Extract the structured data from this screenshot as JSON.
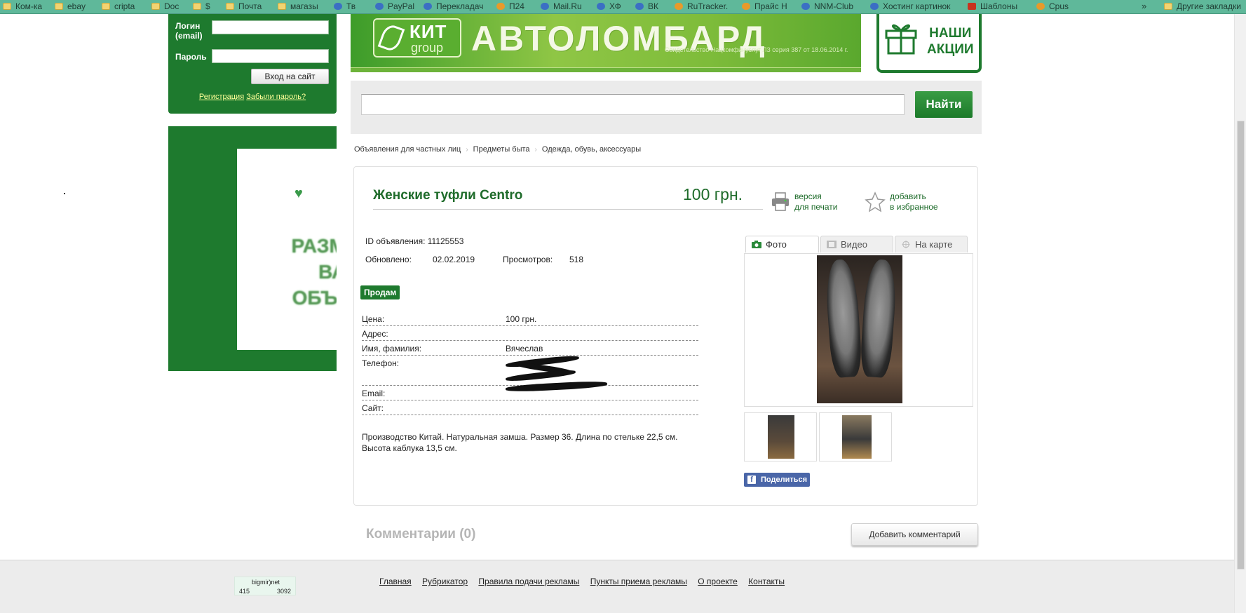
{
  "bookmarks": [
    {
      "label": "Ком-ка",
      "icon": "folder"
    },
    {
      "label": "ebay",
      "icon": "folder"
    },
    {
      "label": "cripta",
      "icon": "folder"
    },
    {
      "label": "Doc",
      "icon": "folder"
    },
    {
      "label": "$",
      "icon": "folder"
    },
    {
      "label": "Почта",
      "icon": "folder"
    },
    {
      "label": "магазы",
      "icon": "folder"
    },
    {
      "label": "Тв",
      "icon": "twitter"
    },
    {
      "label": "PayPal",
      "icon": "paypal"
    },
    {
      "label": "Перекладач",
      "icon": "translate"
    },
    {
      "label": "П24",
      "icon": "p24"
    },
    {
      "label": "Mail.Ru",
      "icon": "mail"
    },
    {
      "label": "ХФ",
      "icon": "hf"
    },
    {
      "label": "ВК",
      "icon": "vk"
    },
    {
      "label": "RuTracker.",
      "icon": "rutracker"
    },
    {
      "label": "Прайс Н",
      "icon": "pin"
    },
    {
      "label": "NNM-Club",
      "icon": "nnm"
    },
    {
      "label": "Хостинг картинок",
      "icon": "hosting"
    },
    {
      "label": "Шаблоны",
      "icon": "vx"
    },
    {
      "label": "Cpus",
      "icon": "cpu"
    }
  ],
  "bookmarks_more": "»",
  "bookmarks_other": "Другие закладки",
  "login": {
    "login_label": "Логин (email)",
    "password_label": "Пароль",
    "submit": "Вход на сайт",
    "register": "Регистрация",
    "forgot": "Забыли пароль?"
  },
  "left_ad": {
    "lines": [
      "РАЗМЕЩ",
      "ВАШЕ",
      "ОБЪЯВЛ"
    ]
  },
  "banner": {
    "logo_top": "КИТ",
    "logo_bottom": "group",
    "main": "АВТОЛОМБАРД",
    "small": "Свидетельство Нацкомфинуслуг ЛЗ серия 387 от 18.06.2014 г."
  },
  "gift": {
    "line1": "НАШИ",
    "line2": "АКЦИИ"
  },
  "search": {
    "value": "",
    "button": "Найти"
  },
  "breadcrumbs": [
    "Объявления для частных лиц",
    "Предметы быта",
    "Одежда, обувь, аксессуары"
  ],
  "breadcrumb_sep": "›",
  "ad": {
    "title": "Женские туфли Centro",
    "price_top": "100 грн.",
    "print_line1": "версия",
    "print_line2": "для печати",
    "fav_line1": "добавить",
    "fav_line2": "в избранное",
    "id_label": "ID объявления:",
    "id_value": "11125553",
    "updated_label": "Обновлено:",
    "updated_value": "02.02.2019",
    "views_label": "Просмотров:",
    "views_value": "518",
    "type_badge": "Продам",
    "rows": [
      {
        "key": "Цена:",
        "value": "100 грн."
      },
      {
        "key": "Адрес:",
        "value": ""
      },
      {
        "key": "Имя, фамилия:",
        "value": "Вячеслав"
      },
      {
        "key": "Телефон:",
        "value": ""
      },
      {
        "key": "Email:",
        "value": ""
      },
      {
        "key": "Сайт:",
        "value": ""
      }
    ],
    "description": "Производство Китай. Натуральная замша. Размер 36. Длина по стельке 22,5 см. Высота каблука 13,5 см."
  },
  "media_tabs": [
    "Фото",
    "Видео",
    "На карте"
  ],
  "share": "Поделиться",
  "comments_title": "Комментарии (0)",
  "add_comment": "Добавить комментарий",
  "counter": {
    "title": "bigmir)net",
    "left": "415",
    "right": "3092"
  },
  "footer_links": [
    "Главная",
    "Рубрикатор",
    "Правила подачи рекламы",
    "Пункты приема рекламы",
    "О проекте",
    "Контакты"
  ],
  "colors": {
    "brand_green": "#1e7a2e",
    "bookmarks_bg": "#5fb89a"
  }
}
